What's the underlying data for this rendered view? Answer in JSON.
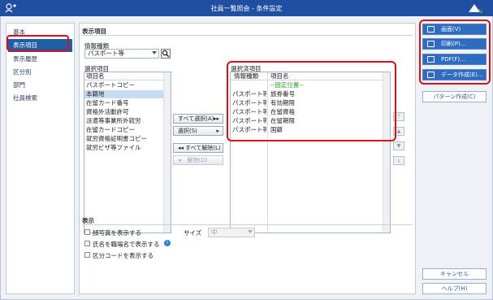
{
  "window": {
    "title": "社員一覧照会 - 条件設定",
    "brand": "AI"
  },
  "sidebar": {
    "items": [
      {
        "label": "基本",
        "active": false
      },
      {
        "label": "表示項目",
        "active": true
      },
      {
        "label": "表示履歴",
        "active": false
      },
      {
        "label": "区分別",
        "active": false
      },
      {
        "label": "部門",
        "active": false
      },
      {
        "label": "社員検索",
        "active": false
      }
    ]
  },
  "display_items": {
    "section_title": "表示項目",
    "info_type_label": "情報種類",
    "info_type_value": "パスポート等",
    "available": {
      "label": "選択項目",
      "header": "項目名",
      "items": [
        "パスポートコピー",
        "本籍地",
        "在留カード番号",
        "資格外活動許可",
        "派遣等事業所外就労",
        "在留カードコピー",
        "就労資格証明書コピー",
        "就労ビザ等ファイル"
      ],
      "selected_index": 1
    },
    "selected": {
      "label": "選択済項目",
      "header_type": "情報種類",
      "header_name": "項目名",
      "fixed_label": "--固定位置--",
      "rows": [
        {
          "type": "パスポート等",
          "name": "旅券番号"
        },
        {
          "type": "パスポート等",
          "name": "有効期限"
        },
        {
          "type": "パスポート等",
          "name": "在留資格"
        },
        {
          "type": "パスポート等",
          "name": "在留期限"
        },
        {
          "type": "パスポート等",
          "name": "国籍"
        }
      ]
    },
    "buttons": {
      "select_all": "すべて選択(A)",
      "select": "選択(S)",
      "deselect_all": "すべて解除(L)",
      "deselect": "解除(D)"
    }
  },
  "display": {
    "section_title": "表示",
    "show_photo": "顔写真を表示する",
    "size_label": "サイズ",
    "size_value": "中",
    "show_name_display": "氏名を職場名で表示する",
    "show_category_code": "区分コードを表示する"
  },
  "actions": {
    "screen": "画面(V)",
    "print": "印刷(P)...",
    "pdf": "PDF(F)...",
    "data_create": "データ作成(E)...",
    "pattern_create": "パターン作成(C)",
    "cancel": "キャンセル",
    "help": "ヘルプ(H)"
  },
  "colors": {
    "titlebar": "#1f4fa0",
    "accent": "#2d6cc0",
    "highlight": "#d6101a",
    "selection": "#c6dcf3"
  }
}
